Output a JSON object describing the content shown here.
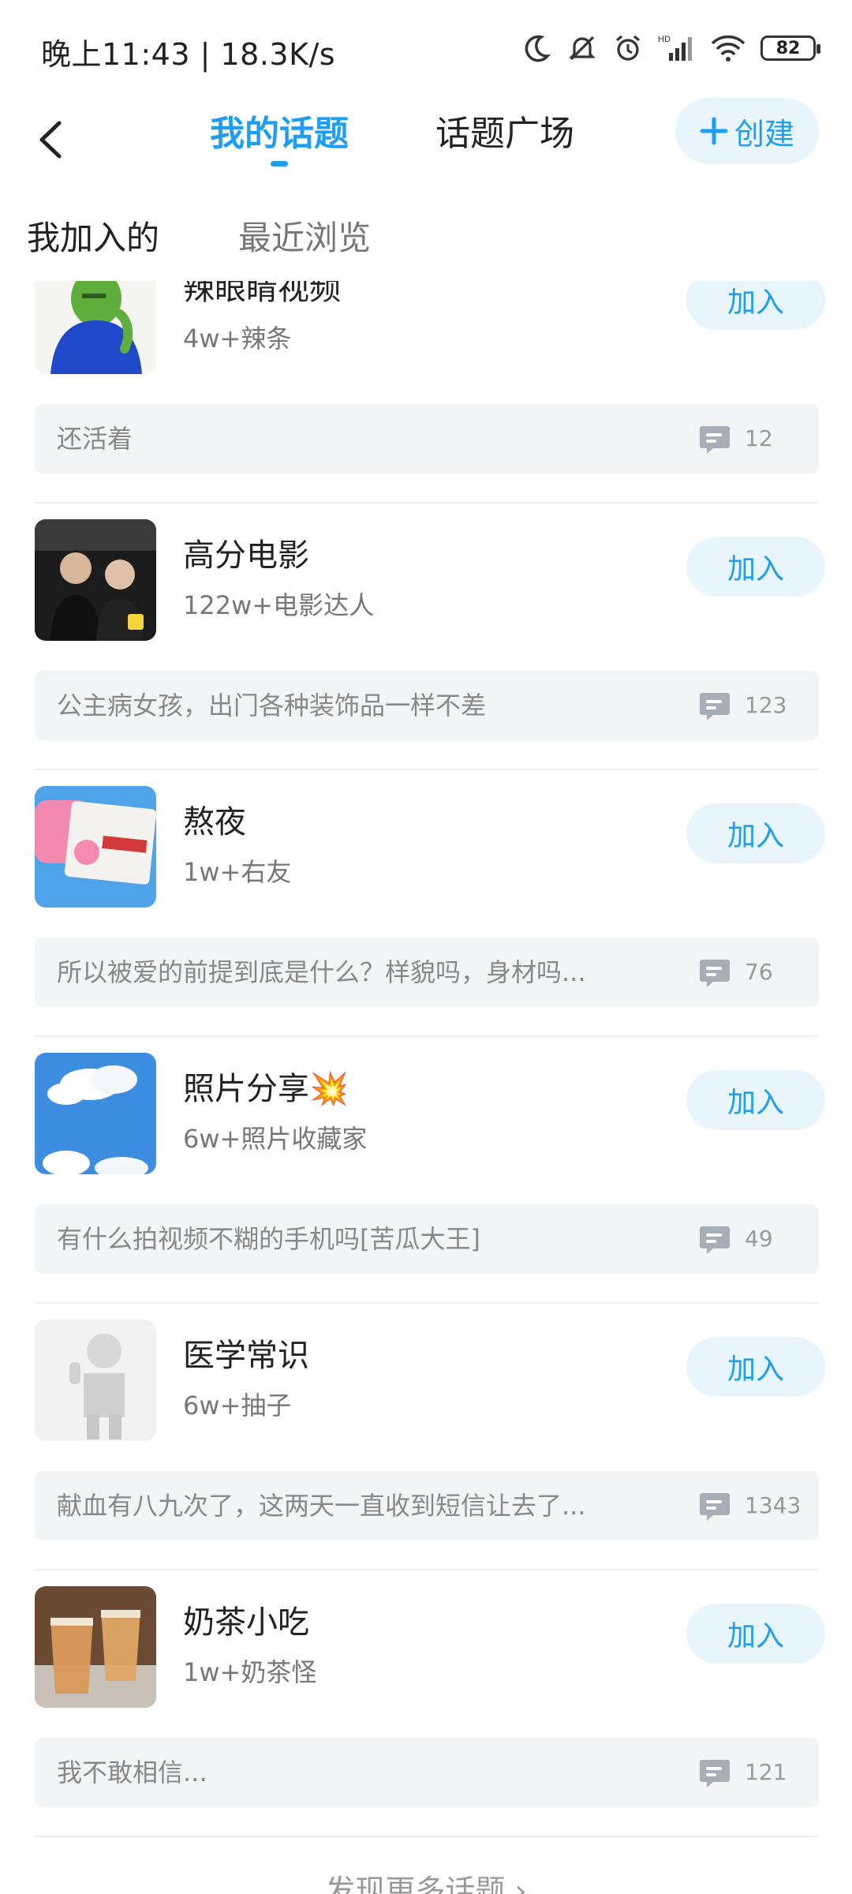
{
  "status_bar": {
    "time_speed": "晚上11:43 | 18.3K/s",
    "battery": "82"
  },
  "header": {
    "tabs": [
      "我的话题",
      "话题广场"
    ],
    "create_label": "创建",
    "accent": "#1e9ef2"
  },
  "subtabs": [
    "我加入的",
    "最近浏览"
  ],
  "join_label": "加入",
  "items": [
    {
      "title": "辣眼睛视频",
      "meta": "4w+辣条",
      "post": "还活着",
      "count": "12",
      "thumb": "green-face-figure"
    },
    {
      "title": "高分电影",
      "meta": "122w+电影达人",
      "post": "公主病女孩，出门各种装饰品一样不差",
      "count": "123",
      "thumb": "movie-still"
    },
    {
      "title": "熬夜",
      "meta": "1w+右友",
      "post": "所以被爱的前提到底是什么？样貌吗，身材吗...",
      "count": "76",
      "thumb": "bikini-bottom-license"
    },
    {
      "title": "照片分享💥",
      "meta": "6w+照片收藏家",
      "post": "有什么拍视频不糊的手机吗[苦瓜大王]",
      "count": "49",
      "thumb": "sky-clouds"
    },
    {
      "title": "医学常识",
      "meta": "6w+抽子",
      "post": "献血有八九次了，这两天一直收到短信让去了...",
      "count": "1343",
      "thumb": "thumbs-up-figure"
    },
    {
      "title": "奶茶小吃",
      "meta": "1w+奶茶怪",
      "post": "我不敢相信...",
      "count": "121",
      "thumb": "milk-tea"
    }
  ],
  "footer": {
    "more_label": "发现更多话题 ›"
  }
}
